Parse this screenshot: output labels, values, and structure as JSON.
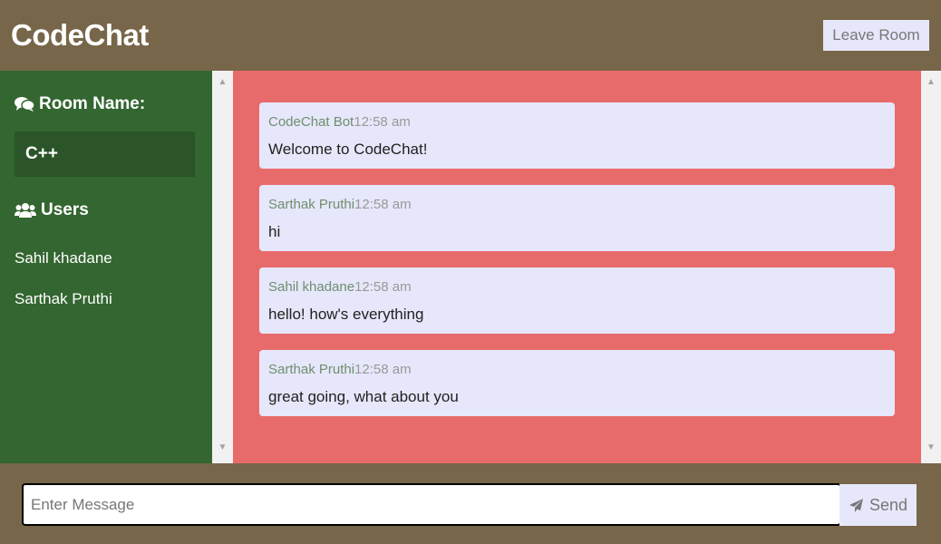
{
  "header": {
    "title": "CodeChat",
    "leave_label": "Leave Room"
  },
  "sidebar": {
    "room_heading": "Room Name:",
    "room_icon": "comments-icon",
    "room_name": "C++",
    "users_heading": "Users",
    "users_icon": "users-icon",
    "users": [
      "Sahil khadane",
      "Sarthak Pruthi"
    ]
  },
  "messages": [
    {
      "author": "CodeChat Bot",
      "time": "12:58 am",
      "text": "Welcome to CodeChat!"
    },
    {
      "author": "Sarthak Pruthi",
      "time": "12:58 am",
      "text": "hi"
    },
    {
      "author": "Sahil khadane",
      "time": "12:58 am",
      "text": "hello! how's everything"
    },
    {
      "author": "Sarthak Pruthi",
      "time": "12:58 am",
      "text": "great going, what about you"
    }
  ],
  "composer": {
    "placeholder": "Enter Message",
    "value": "",
    "send_label": "Send",
    "send_icon": "paper-plane-icon"
  },
  "colors": {
    "header": "#776649",
    "sidebar": "#336630",
    "chat_bg": "#e86b6b",
    "bubble": "#e6e7fa",
    "author": "#6e8f6e"
  }
}
